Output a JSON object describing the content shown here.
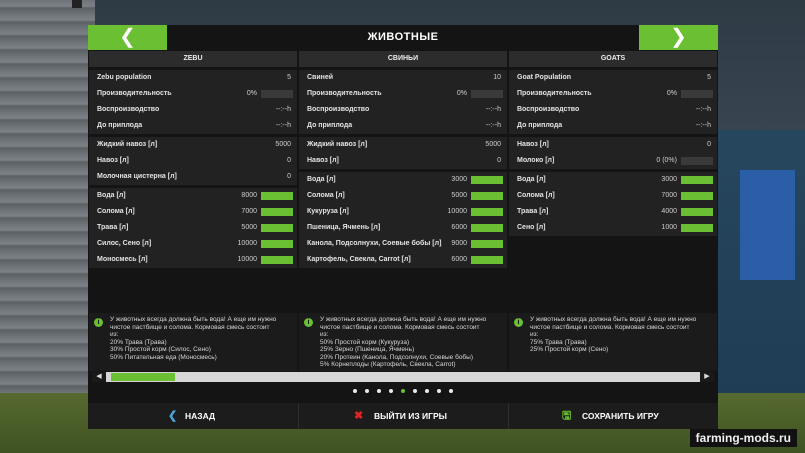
{
  "title": "ЖИВОТНЫЕ",
  "nav": {
    "prev": "❮",
    "next": "❯"
  },
  "columns": [
    {
      "header": "ZEBU",
      "group1": [
        {
          "label": "Zebu population",
          "value": "5"
        },
        {
          "label": "Производительность",
          "value": "0%",
          "bar": 0
        },
        {
          "label": "Воспроизводство",
          "value": "--:--h"
        },
        {
          "label": "До приплода",
          "value": "--:--h"
        }
      ],
      "group2": [
        {
          "label": "Жидкий навоз [л]",
          "value": "5000"
        },
        {
          "label": "Навоз [л]",
          "value": "0"
        },
        {
          "label": "Молочная цистерна [л]",
          "value": "0"
        }
      ],
      "group3": [
        {
          "label": "Вода [л]",
          "value": "8000",
          "bar": 1
        },
        {
          "label": "Солома [л]",
          "value": "7000",
          "bar": 1
        },
        {
          "label": "Трава [л]",
          "value": "5000",
          "bar": 1
        },
        {
          "label": "Силос, Сено [л]",
          "value": "10000",
          "bar": 1
        },
        {
          "label": "Моносмесь [л]",
          "value": "10000",
          "bar": 1
        }
      ],
      "info": [
        "У животных всегда должна быть вода! А еще им нужно",
        "чистое пастбище и солома. Кормовая смесь состоит",
        "из:",
        "20% Трава (Трава)",
        "30% Простой корм (Силос, Сено)",
        "50% Питательная еда (Моносмесь)"
      ]
    },
    {
      "header": "СВИНЬИ",
      "group1": [
        {
          "label": "Свиней",
          "value": "10"
        },
        {
          "label": "Производительность",
          "value": "0%",
          "bar": 0
        },
        {
          "label": "Воспроизводство",
          "value": "--:--h"
        },
        {
          "label": "До приплода",
          "value": "--:--h"
        }
      ],
      "group2": [
        {
          "label": "Жидкий навоз [л]",
          "value": "5000"
        },
        {
          "label": "Навоз [л]",
          "value": "0"
        }
      ],
      "group3": [
        {
          "label": "Вода [л]",
          "value": "3000",
          "bar": 1
        },
        {
          "label": "Солома [л]",
          "value": "5000",
          "bar": 1
        },
        {
          "label": "Кукуруза [л]",
          "value": "10000",
          "bar": 1
        },
        {
          "label": "Пшеница, Ячмень [л]",
          "value": "6000",
          "bar": 1
        },
        {
          "label": "Канола, Подсолнухи, Соевые бобы [л]",
          "value": "9000",
          "bar": 1
        },
        {
          "label": "Картофель, Свекла, Carrot [л]",
          "value": "6000",
          "bar": 1
        }
      ],
      "info": [
        "У животных всегда должна быть вода! А еще им нужно",
        "чистое пастбище и солома. Кормовая смесь состоит",
        "из:",
        "50% Простой корм (Кукуруза)",
        "25% Зерно (Пшеница, Ячмень)",
        "20% Протеин (Канола, Подсолнухи, Соевые бобы)",
        "5% Корнеплоды (Картофель, Свекла, Carrot)"
      ]
    },
    {
      "header": "GOATS",
      "group1": [
        {
          "label": "Goat Population",
          "value": "5"
        },
        {
          "label": "Производительность",
          "value": "0%",
          "bar": 0
        },
        {
          "label": "Воспроизводство",
          "value": "--:--h"
        },
        {
          "label": "До приплода",
          "value": "--:--h"
        }
      ],
      "group2": [
        {
          "label": "Навоз [л]",
          "value": "0"
        },
        {
          "label": "Молоко [л]",
          "value": "0 (0%)",
          "bar": 0
        }
      ],
      "group3": [
        {
          "label": "Вода [л]",
          "value": "3000",
          "bar": 1
        },
        {
          "label": "Солома [л]",
          "value": "7000",
          "bar": 1
        },
        {
          "label": "Трава [л]",
          "value": "4000",
          "bar": 1
        },
        {
          "label": "Сено [л]",
          "value": "1000",
          "bar": 1
        }
      ],
      "info": [
        "У животных всегда должна быть вода! А еще им нужно",
        "чистое пастбище и солома. Кормовая смесь состоит",
        "из:",
        "75% Трава (Трава)",
        "25% Простой корм (Сено)"
      ]
    }
  ],
  "scroll": {
    "left_arrow": "◀",
    "right_arrow": "▶"
  },
  "pages": {
    "count": 9,
    "active": 4
  },
  "footer": {
    "back_label": "НАЗАД",
    "quit_label": "ВЫЙТИ ИЗ ИГРЫ",
    "save_label": "СОХРАНИТЬ ИГРУ"
  },
  "icons": {
    "back": "chevron-left-icon",
    "quit": "close-icon",
    "save": "floppy-disk-icon",
    "info": "info-icon"
  },
  "colors": {
    "accent": "#6abf32",
    "back_icon": "#4ba3d9",
    "quit_icon": "#e02424",
    "panel": "#141414"
  },
  "watermark": "farming-mods.ru"
}
